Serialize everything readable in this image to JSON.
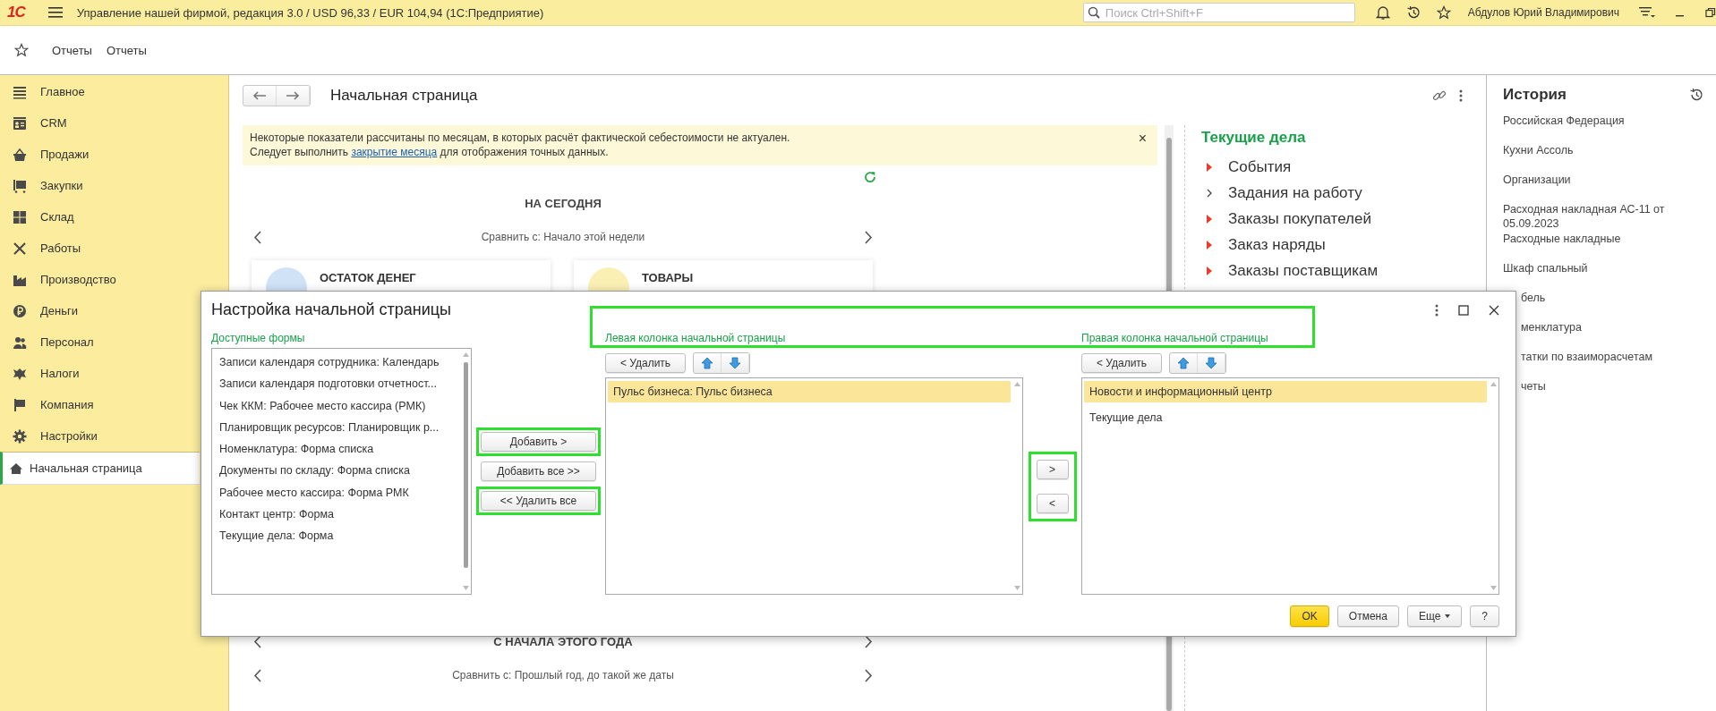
{
  "app_bar": {
    "logo": "1С",
    "title": "Управление нашей фирмой, редакция 3.0 / USD 96,33 / EUR 104,94  (1С:Предприятие)",
    "search": {
      "placeholder": "Поиск Ctrl+Shift+F"
    },
    "user": "Абдулов Юрий Владимирович"
  },
  "toolbar": {
    "links": [
      "Отчеты",
      "Отчеты"
    ]
  },
  "sidebar": {
    "items": [
      {
        "label": "Главное",
        "selected": false
      },
      {
        "label": "CRM",
        "selected": false
      },
      {
        "label": "Продажи",
        "selected": false
      },
      {
        "label": "Закупки",
        "selected": false
      },
      {
        "label": "Склад",
        "selected": false
      },
      {
        "label": "Работы",
        "selected": false
      },
      {
        "label": "Производство",
        "selected": false
      },
      {
        "label": "Деньги",
        "selected": false
      },
      {
        "label": "Персонал",
        "selected": false
      },
      {
        "label": "Налоги",
        "selected": false
      },
      {
        "label": "Компания",
        "selected": false
      },
      {
        "label": "Настройки",
        "selected": false
      },
      {
        "label": "Начальная страница",
        "selected": true
      }
    ]
  },
  "page": {
    "title": "Начальная страница",
    "notice": {
      "line_1": "Некоторые показатели рассчитаны по месяцам, в которых расчёт фактической себестоимости не актуален.",
      "before_link": "Следует выполнить",
      "link": "закрытие месяца",
      "after_link": "для отображения точных данных.",
      "close": "×"
    },
    "today": {
      "heading": "НА СЕГОДНЯ",
      "compare": "Сравнить с: Начало этой недели",
      "cards": [
        {
          "title": "ОСТАТОК ДЕНЕГ",
          "color": "#cfe2f6"
        },
        {
          "title": "ТОВАРЫ",
          "color": "#fbf0b4"
        }
      ]
    },
    "year": {
      "heading": "С НАЧАЛА ЭТОГО ГОДА",
      "compare": "Сравнить с: Прошлый год, до такой же даты"
    }
  },
  "tasks": {
    "title": "Текущие дела",
    "items": [
      {
        "label": "События",
        "kind": "alert"
      },
      {
        "label": "Задания на работу",
        "kind": "plain"
      },
      {
        "label": "Заказы покупателей",
        "kind": "alert"
      },
      {
        "label": "Заказ наряды",
        "kind": "alert"
      },
      {
        "label": "Заказы поставщикам",
        "kind": "alert"
      }
    ]
  },
  "history": {
    "title": "История",
    "items": [
      {
        "label": "Российская Федерация",
        "covered": false
      },
      {
        "label": "Кухни Ассоль",
        "covered": false
      },
      {
        "label": "Организации",
        "covered": false
      },
      {
        "label": "Расходная накладная АС-11 от 05.09.2023",
        "covered": false
      },
      {
        "label": "Расходные накладные",
        "covered": false
      },
      {
        "label": "Шкаф спальный",
        "covered": false
      },
      {
        "label": "бель",
        "covered": true
      },
      {
        "label": "менклатура",
        "covered": true
      },
      {
        "label": "татки по взаиморасчетам",
        "covered": true
      },
      {
        "label": "четы",
        "covered": true
      }
    ]
  },
  "dialog": {
    "title": "Настройка начальной страницы",
    "headers_highlighted": true,
    "available": {
      "label": "Доступные формы",
      "items": [
        {
          "label": "Записи календаря сотрудника: Календарь",
          "selected": false
        },
        {
          "label": "Записи календаря подготовки отчетност...",
          "selected": false
        },
        {
          "label": "Чек ККМ: Рабочее место кассира (РМК)",
          "selected": false
        },
        {
          "label": "Планировщик ресурсов: Планировщик р...",
          "selected": false
        },
        {
          "label": "Номенклатура: Форма списка",
          "selected": false
        },
        {
          "label": "Документы по складу: Форма списка",
          "selected": false
        },
        {
          "label": "Рабочее место кассира: Форма РМК",
          "selected": false
        },
        {
          "label": "Контакт центр: Форма",
          "selected": false
        },
        {
          "label": "Текущие дела: Форма",
          "selected": false
        }
      ]
    },
    "add_buttons": [
      {
        "label": "Добавить >",
        "highlighted": true
      },
      {
        "label": "Добавить все >>",
        "highlighted": false
      },
      {
        "label": "<< Удалить все",
        "highlighted": true
      }
    ],
    "left_column": {
      "label": "Левая колонка начальной страницы",
      "remove": "< Удалить",
      "items": [
        {
          "label": "Пульс бизнеса: Пульс бизнеса",
          "selected": true
        }
      ]
    },
    "move_buttons": {
      "highlighted": true,
      "labels": [
        ">",
        "<"
      ]
    },
    "right_column": {
      "label": "Правая колонка начальной страницы",
      "remove": "< Удалить",
      "items": [
        {
          "label": "Новости и информационный центр",
          "selected": true
        },
        {
          "label": "Текущие дела",
          "selected": false
        }
      ]
    },
    "footer": [
      {
        "label": "OK",
        "kind": "default"
      },
      {
        "label": "Отмена",
        "kind": "plain"
      },
      {
        "label": "Еще",
        "kind": "menu"
      },
      {
        "label": "?",
        "kind": "plain"
      }
    ]
  }
}
